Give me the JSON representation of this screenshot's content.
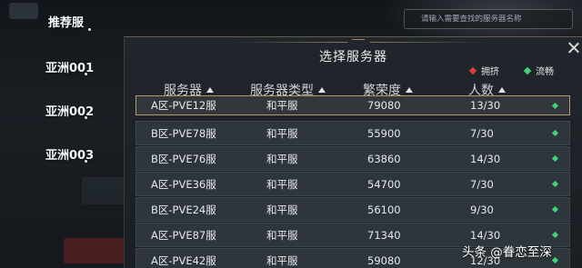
{
  "nav": {
    "items": [
      {
        "label": "推荐服"
      },
      {
        "label": "亚洲001"
      },
      {
        "label": "亚洲002"
      },
      {
        "label": "亚洲003"
      }
    ]
  },
  "search": {
    "placeholder": "请输入需要查找的服务器名称"
  },
  "modal": {
    "title": "选择服务器",
    "legend": {
      "crowded": {
        "label": "拥挤",
        "color": "#e03b3b"
      },
      "smooth": {
        "label": "流畅",
        "color": "#3fd47a"
      }
    },
    "columns": [
      {
        "label": "服务器"
      },
      {
        "label": "服务器类型"
      },
      {
        "label": "繁荣度"
      },
      {
        "label": "人数"
      }
    ],
    "rows": [
      {
        "name": "A区-PVE12服",
        "type": "和平服",
        "prosperity": "79080",
        "count": "13/30",
        "status": "smooth"
      },
      {
        "name": "B区-PVE78服",
        "type": "和平服",
        "prosperity": "55900",
        "count": "7/30",
        "status": "smooth"
      },
      {
        "name": "B区-PVE76服",
        "type": "和平服",
        "prosperity": "63860",
        "count": "14/30",
        "status": "smooth"
      },
      {
        "name": "A区-PVE36服",
        "type": "和平服",
        "prosperity": "54700",
        "count": "7/30",
        "status": "smooth"
      },
      {
        "name": "B区-PVE24服",
        "type": "和平服",
        "prosperity": "56100",
        "count": "9/30",
        "status": "smooth"
      },
      {
        "name": "A区-PVE87服",
        "type": "和平服",
        "prosperity": "71340",
        "count": "14/30",
        "status": "smooth"
      },
      {
        "name": "A区-PVE42服",
        "type": "和平服",
        "prosperity": "59080",
        "count": "12/30",
        "status": "smooth"
      }
    ]
  },
  "watermark": "头条 @眷恋至深"
}
